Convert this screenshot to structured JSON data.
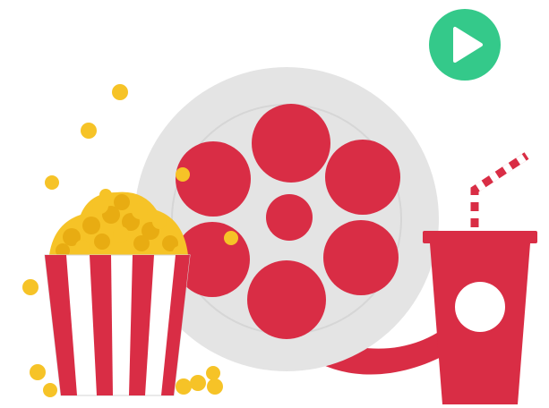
{
  "illustration": {
    "elements": [
      "play-button",
      "film-reel",
      "popcorn-bucket",
      "soda-cup"
    ]
  },
  "colors": {
    "background": "#ffffff",
    "accent_red": "#d92d45",
    "reel_grey": "#e4e4e4",
    "reel_grey_dark": "#d6d6d6",
    "play_green": "#34c98a",
    "play_arrow": "#ffffff",
    "popcorn_gold": "#f6c327",
    "popcorn_gold_dark": "#e8ac12",
    "stripe_white": "#ffffff"
  },
  "icons": {
    "play": "play-icon",
    "reel": "film-reel-icon",
    "popcorn": "popcorn-icon",
    "soda": "soda-cup-icon"
  }
}
